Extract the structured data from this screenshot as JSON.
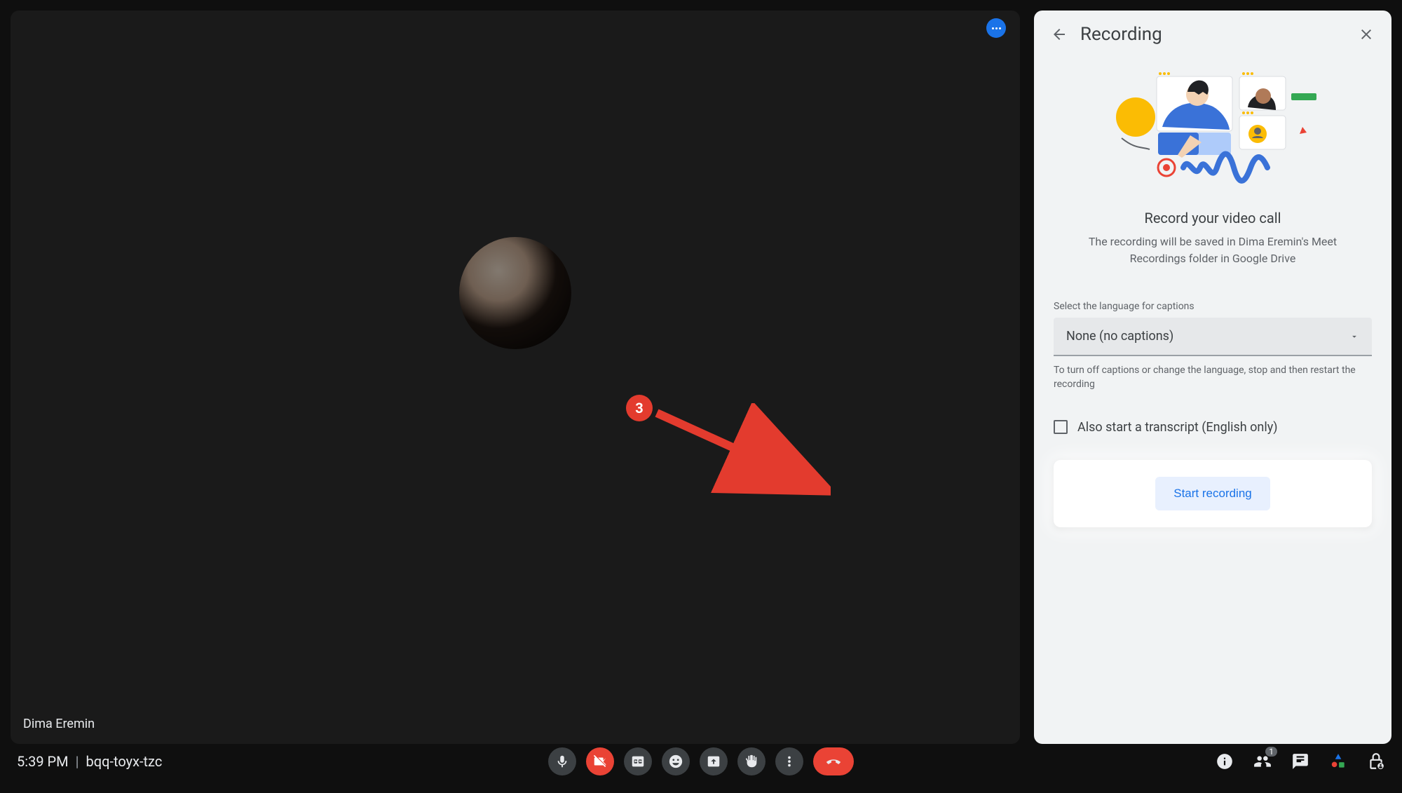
{
  "participant_name": "Dima Eremin",
  "time": "5:39 PM",
  "meet_code": "bqq-toyx-tzc",
  "participants_count": "1",
  "panel": {
    "title": "Recording",
    "heading": "Record your video call",
    "description": "The recording will be saved in Dima Eremin's Meet Recordings folder in Google Drive",
    "captions_label": "Select the language for captions",
    "captions_value": "None (no captions)",
    "captions_hint": "To turn off captions or change the language, stop and then restart the recording",
    "transcript_label": "Also start a transcript (English only)",
    "start_label": "Start recording"
  },
  "annotation": {
    "step": "3"
  }
}
